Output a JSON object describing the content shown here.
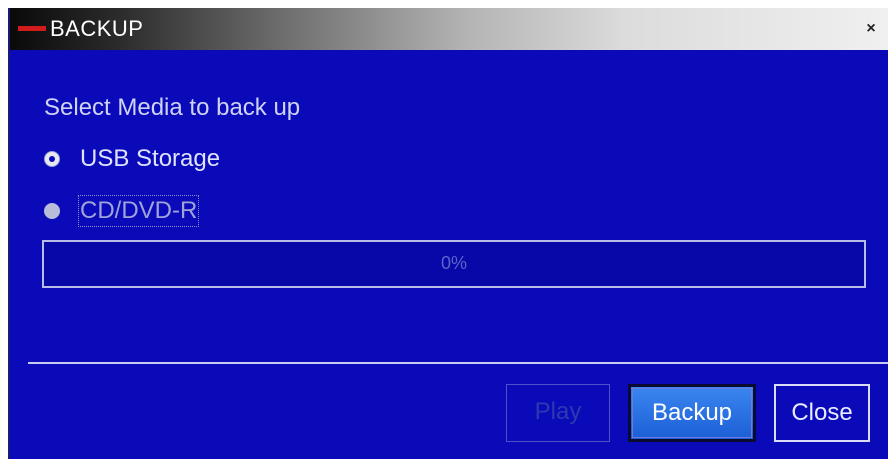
{
  "window": {
    "title": "BACKUP",
    "close_glyph": "×"
  },
  "dialog": {
    "prompt": "Select Media to back up",
    "options": [
      {
        "label": "USB Storage",
        "selected": true
      },
      {
        "label": "CD/DVD-R",
        "selected": false
      }
    ],
    "progress": {
      "value_percent": 0,
      "label": "0%"
    }
  },
  "buttons": {
    "play_label": "Play",
    "backup_label": "Backup",
    "close_label": "Close"
  },
  "colors": {
    "background": "#0a0ab8",
    "accent": "#d21c1c",
    "primary_button": "#2a72e6"
  }
}
